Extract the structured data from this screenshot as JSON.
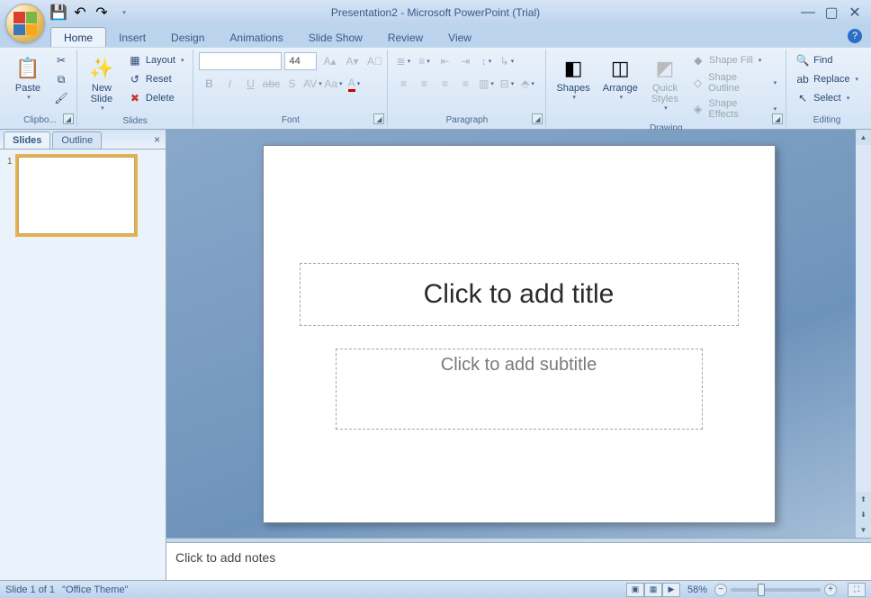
{
  "titlebar": {
    "title": "Presentation2 - Microsoft PowerPoint (Trial)"
  },
  "tabs": {
    "items": [
      "Home",
      "Insert",
      "Design",
      "Animations",
      "Slide Show",
      "Review",
      "View"
    ],
    "active": "Home"
  },
  "ribbon": {
    "clipboard": {
      "label": "Clipbo...",
      "paste": "Paste"
    },
    "slides": {
      "label": "Slides",
      "new_slide": "New\nSlide",
      "layout": "Layout",
      "reset": "Reset",
      "delete": "Delete"
    },
    "font": {
      "label": "Font",
      "size": "44"
    },
    "paragraph": {
      "label": "Paragraph"
    },
    "drawing": {
      "label": "Drawing",
      "shapes": "Shapes",
      "arrange": "Arrange",
      "quick_styles": "Quick\nStyles",
      "shape_fill": "Shape Fill",
      "shape_outline": "Shape Outline",
      "shape_effects": "Shape Effects"
    },
    "editing": {
      "label": "Editing",
      "find": "Find",
      "replace": "Replace",
      "select": "Select"
    }
  },
  "leftpane": {
    "tabs": {
      "slides": "Slides",
      "outline": "Outline"
    },
    "thumb_number": "1"
  },
  "slide": {
    "title_placeholder": "Click to add title",
    "subtitle_placeholder": "Click to add subtitle"
  },
  "notes": {
    "placeholder": "Click to add notes"
  },
  "status": {
    "slide_info": "Slide 1 of 1",
    "theme": "\"Office Theme\"",
    "zoom": "58%"
  }
}
